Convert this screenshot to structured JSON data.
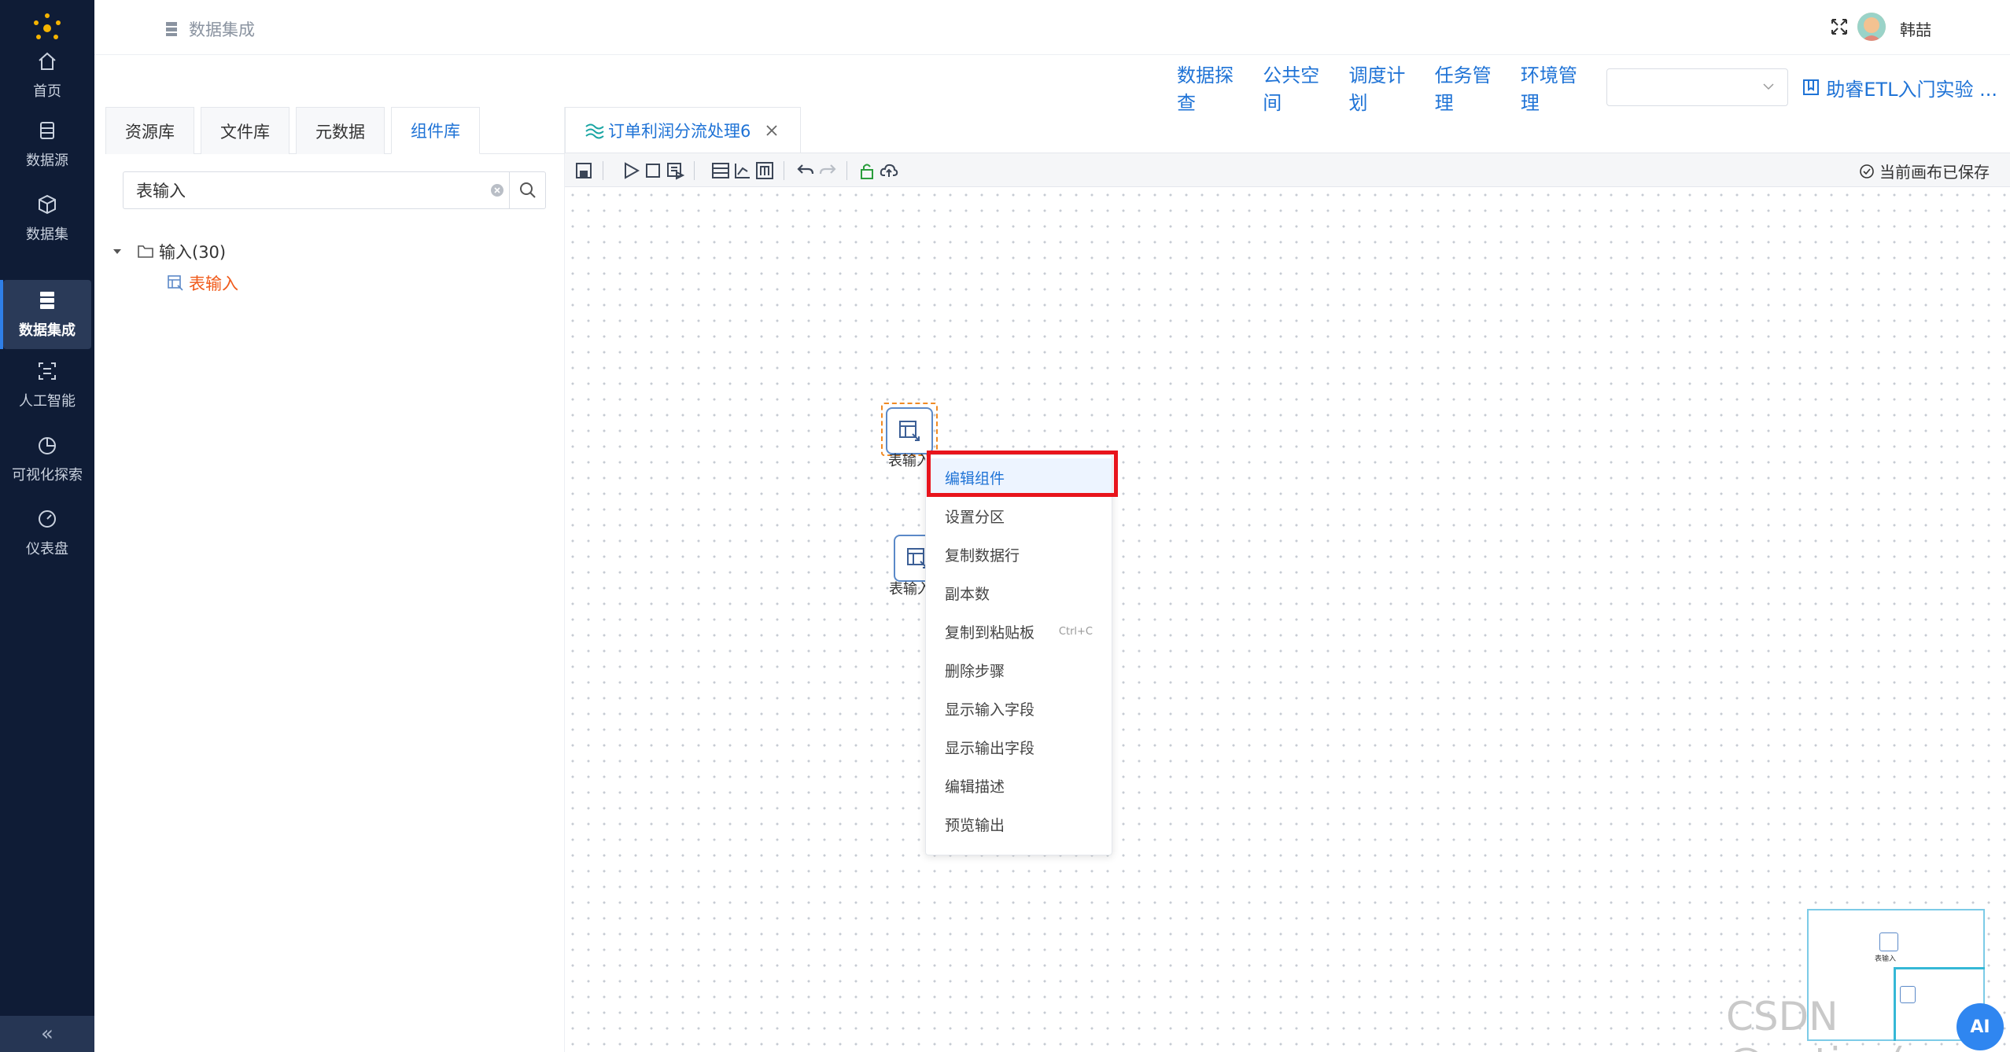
{
  "app": {
    "logo": "snowflake-logo",
    "breadcrumb": "数据集成",
    "user_name": "韩喆"
  },
  "sidebar": {
    "items": [
      {
        "label": "首页",
        "icon": "home-icon"
      },
      {
        "label": "数据源",
        "icon": "database-icon"
      },
      {
        "label": "数据集",
        "icon": "cube-icon"
      },
      {
        "label": "数据集成",
        "icon": "server-stack-icon",
        "active": true
      },
      {
        "label": "人工智能",
        "icon": "scan-icon"
      },
      {
        "label": "可视化探索",
        "icon": "pie-chart-icon"
      },
      {
        "label": "仪表盘",
        "icon": "gauge-icon"
      }
    ],
    "collapse_label": "«"
  },
  "menubar": {
    "items": [
      "数据探查",
      "公共空间",
      "调度计划",
      "任务管理",
      "环境管理"
    ],
    "env_select_value": "",
    "guide_label": "助睿ETL入门实验 ..."
  },
  "left_panel": {
    "tabs": [
      "资源库",
      "文件库",
      "元数据",
      "组件库"
    ],
    "active_tab": "组件库",
    "search_value": "表输入",
    "tree": {
      "folder_label": "输入(30)",
      "leaf_label": "表输入"
    }
  },
  "editor": {
    "tab_title": "订单利润分流处理6",
    "save_status": "当前画布已保存",
    "nodes": [
      {
        "label": "表输入"
      },
      {
        "label": "表输入"
      }
    ]
  },
  "context_menu": {
    "items": [
      {
        "label": "编辑组件",
        "highlighted": true
      },
      {
        "label": "设置分区"
      },
      {
        "label": "复制数据行"
      },
      {
        "label": "副本数"
      },
      {
        "label": "复制到粘贴板",
        "shortcut": "Ctrl+C"
      },
      {
        "label": "删除步骤"
      },
      {
        "label": "显示输入字段"
      },
      {
        "label": "显示输出字段"
      },
      {
        "label": "编辑描述"
      },
      {
        "label": "预览输出"
      }
    ]
  },
  "minimap": {
    "nodes": [
      {
        "label": "表输入"
      }
    ]
  },
  "watermark": "CSDN @potion(",
  "watermark_badge": "AI",
  "colors": {
    "sidebar_bg": "#0f1c36",
    "accent": "#1f73d6",
    "tree_leaf": "#f05a1a",
    "highlight_box": "#e8141c"
  }
}
